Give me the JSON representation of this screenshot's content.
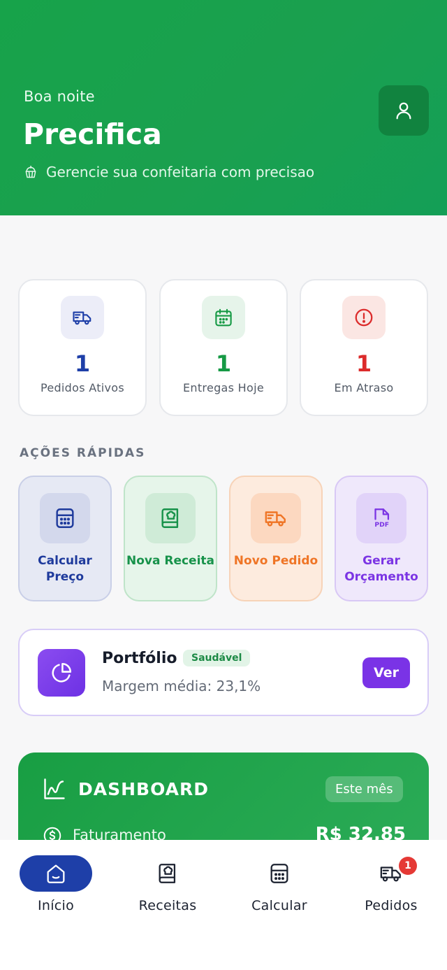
{
  "header": {
    "greeting": "Boa noite",
    "title": "Precifica",
    "subtitle": "Gerencie sua confeitaria com precisao",
    "profile_icon": "user-icon"
  },
  "stats": [
    {
      "value": "1",
      "label": "Pedidos Ativos",
      "icon": "truck-icon",
      "color": "#1e3fa8",
      "bg": "#ecedf8"
    },
    {
      "value": "1",
      "label": "Entregas Hoje",
      "icon": "calendar-icon",
      "color": "#169a45",
      "bg": "#e6f4ea"
    },
    {
      "value": "1",
      "label": "Em Atraso",
      "icon": "alert-circle-icon",
      "color": "#dc2b2b",
      "bg": "#fbe6e3"
    }
  ],
  "quick_actions": {
    "title": "AÇÕES RÁPIDAS",
    "items": [
      {
        "label": "Calcular Preço",
        "icon": "calculator-icon",
        "color": "#1e3a9c",
        "bg": "#e6e9f4",
        "border": "#c9cfe7",
        "icon_bg": "#d3d8ec"
      },
      {
        "label": "Nova Receita",
        "icon": "recipe-book-icon",
        "color": "#17924a",
        "bg": "#e6f5ea",
        "border": "#bfe4c9",
        "icon_bg": "#cfebd7"
      },
      {
        "label": "Novo Pedido",
        "icon": "truck-icon",
        "color": "#ef7526",
        "bg": "#fdebde",
        "border": "#f7d3b8",
        "icon_bg": "#fcd8c0"
      },
      {
        "label": "Gerar Orçamento",
        "icon": "pdf-icon",
        "color": "#7b35e4",
        "bg": "#efe8fb",
        "border": "#d8c8f5",
        "icon_bg": "#e1d3f9"
      }
    ]
  },
  "portfolio": {
    "title": "Portfólio",
    "badge": "Saudável",
    "subtitle": "Margem média: 23,1%",
    "button": "Ver"
  },
  "dashboard": {
    "title": "DASHBOARD",
    "period": "Este mês",
    "rows": [
      {
        "label": "Faturamento",
        "value": "R$ 32,85"
      }
    ]
  },
  "nav": {
    "items": [
      {
        "label": "Início",
        "icon": "home-icon",
        "active": true
      },
      {
        "label": "Receitas",
        "icon": "recipe-book-icon",
        "active": false
      },
      {
        "label": "Calcular",
        "icon": "calculator-icon",
        "active": false
      },
      {
        "label": "Pedidos",
        "icon": "truck-icon",
        "active": false,
        "badge": "1"
      }
    ],
    "active_color": "#1e3fa8"
  }
}
